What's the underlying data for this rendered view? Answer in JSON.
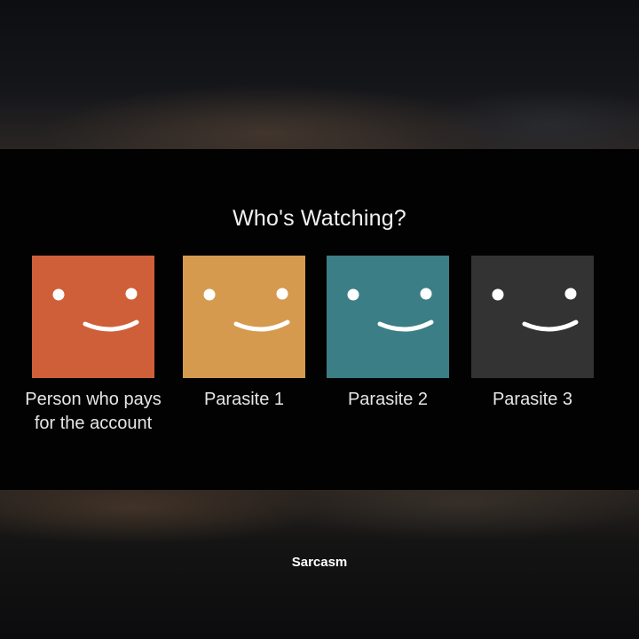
{
  "header": {
    "title": "Who's Watching?"
  },
  "profiles": [
    {
      "name": "Person who pays for the account",
      "color": "#cf5f39"
    },
    {
      "name": "Parasite 1",
      "color": "#d59a4e"
    },
    {
      "name": "Parasite 2",
      "color": "#3b7e86"
    },
    {
      "name": "Parasite 3",
      "color": "#333333"
    }
  ],
  "caption": {
    "text": "Sarcasm"
  },
  "icons": {
    "avatar": "smiley-face-icon"
  }
}
